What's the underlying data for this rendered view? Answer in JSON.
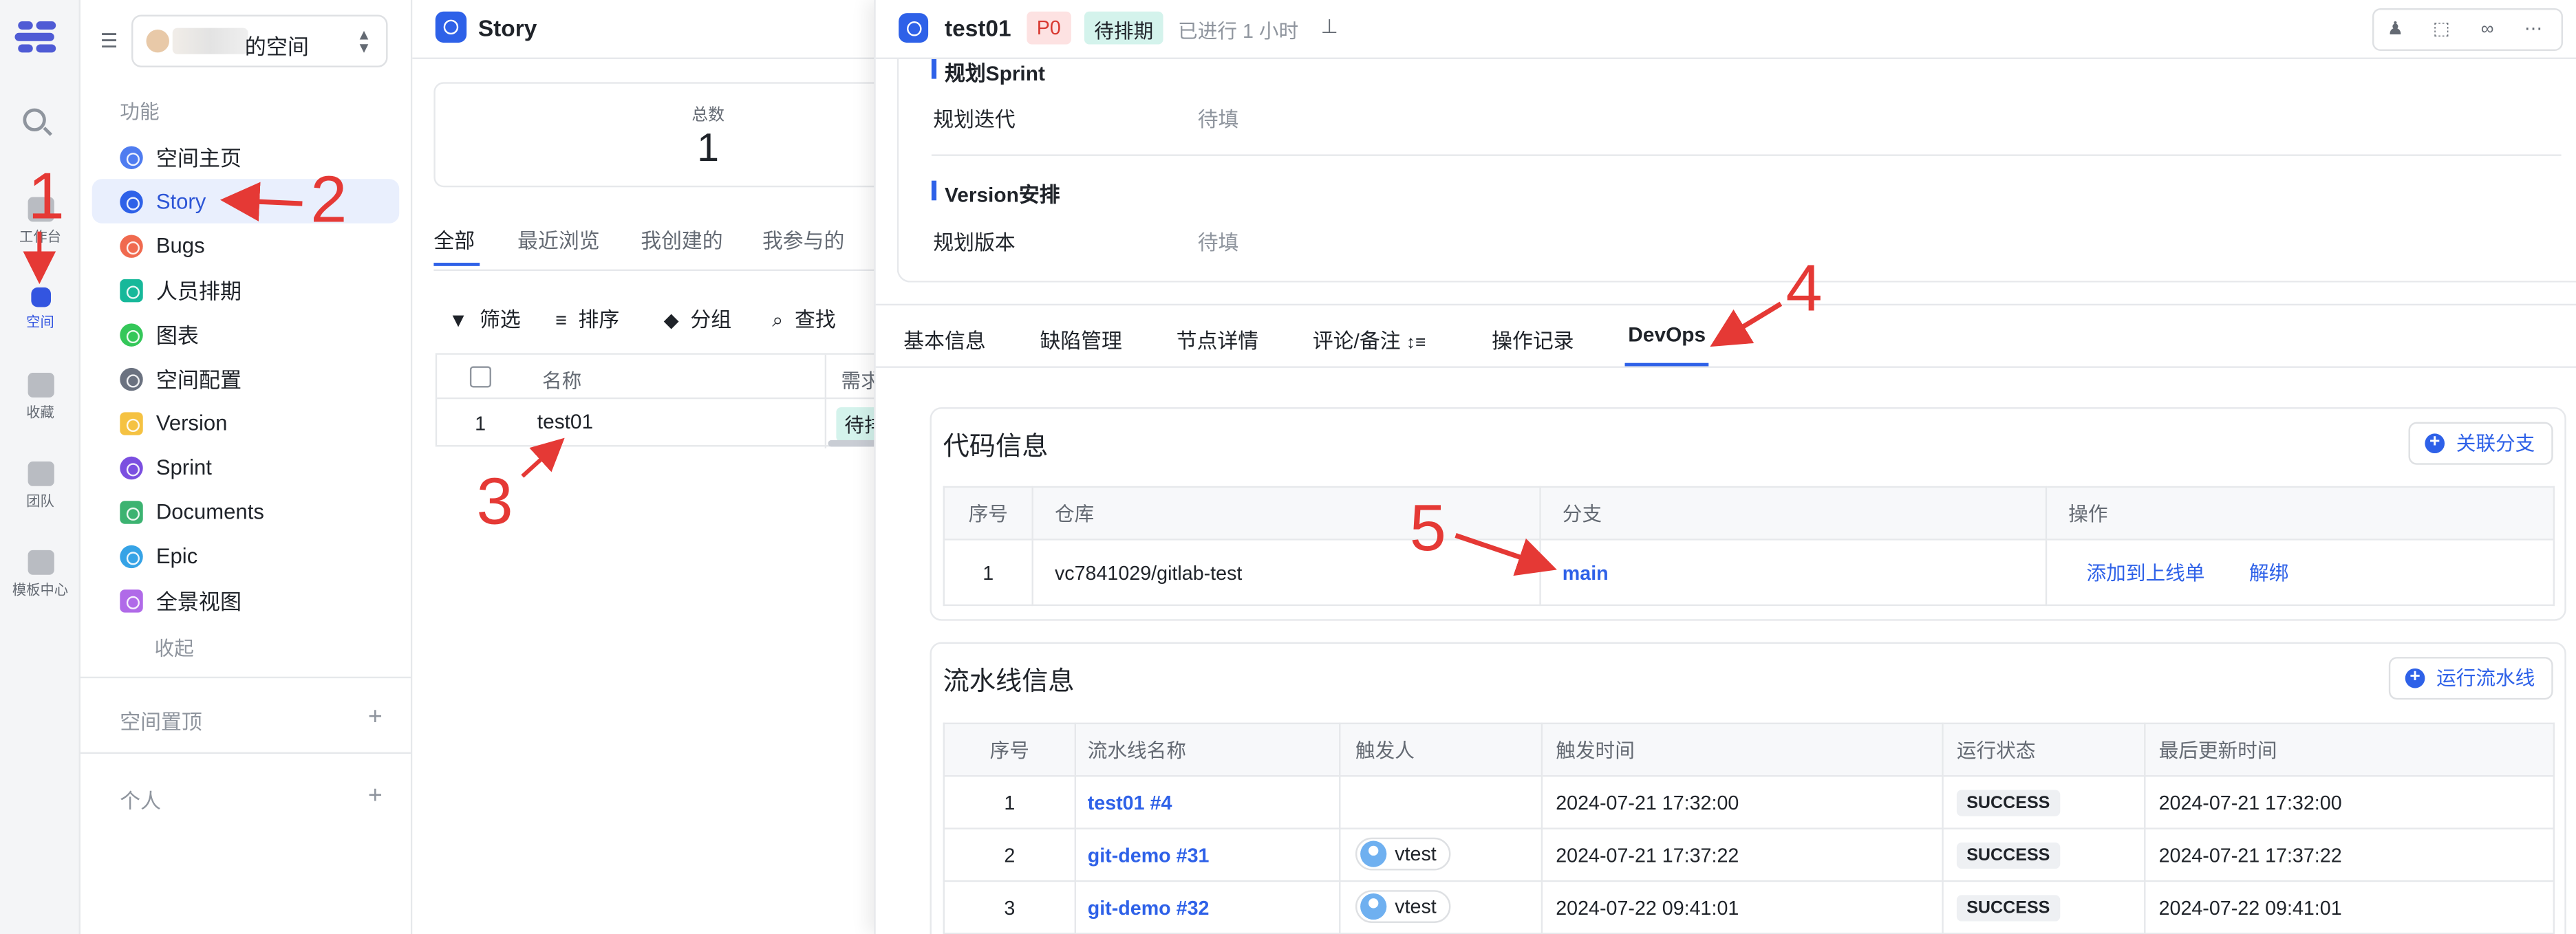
{
  "rail": {
    "items": [
      {
        "label": "工作台",
        "icon": "home-icon"
      },
      {
        "label": "空间",
        "icon": "space-icon"
      },
      {
        "label": "收藏",
        "icon": "star-icon"
      },
      {
        "label": "团队",
        "icon": "team-icon"
      },
      {
        "label": "模板中心",
        "icon": "template-icon"
      }
    ]
  },
  "sidebar": {
    "space_name": "的空间",
    "section_label": "功能",
    "items": [
      {
        "label": "空间主页",
        "color": "#4f7cf0"
      },
      {
        "label": "Story",
        "color": "#2e61e8"
      },
      {
        "label": "Bugs",
        "color": "#f06a4f"
      },
      {
        "label": "人员排期",
        "color": "#17b89a"
      },
      {
        "label": "图表",
        "color": "#34c759"
      },
      {
        "label": "空间配置",
        "color": "#6b7280"
      },
      {
        "label": "Version",
        "color": "#f5c242"
      },
      {
        "label": "Sprint",
        "color": "#7b4fe0"
      },
      {
        "label": "Documents",
        "color": "#3cb371"
      },
      {
        "label": "Epic",
        "color": "#36a3e6"
      },
      {
        "label": "全景视图",
        "color": "#b06ae8"
      }
    ],
    "collapse_label": "收起",
    "pinned_label": "空间置顶",
    "personal_label": "个人"
  },
  "list": {
    "title": "Story",
    "stat_label": "总数",
    "stat_value": "1",
    "tabs": [
      "全部",
      "最近浏览",
      "我创建的",
      "我参与的"
    ],
    "tools": [
      "筛选",
      "排序",
      "分组",
      "查找"
    ],
    "columns": {
      "name": "名称",
      "req": "需求"
    },
    "row": {
      "index": "1",
      "name": "test01",
      "status": "待排"
    }
  },
  "detail": {
    "title": "test01",
    "priority": "P0",
    "status": "待排期",
    "elapsed": "已进行 1 小时",
    "sprint_section": "规划Sprint",
    "sprint_key": "规划迭代",
    "sprint_value": "待填",
    "version_section": "Version安排",
    "version_key": "规划版本",
    "version_value": "待填",
    "tabs": [
      "基本信息",
      "缺陷管理",
      "节点详情",
      "评论/备注",
      "操作记录",
      "DevOps"
    ],
    "code": {
      "title": "代码信息",
      "button": "关联分支",
      "columns": [
        "序号",
        "仓库",
        "分支",
        "操作"
      ],
      "rows": [
        {
          "index": "1",
          "repo": "vc7841029/gitlab-test",
          "branch": "main",
          "action1": "添加到上线单",
          "action2": "解绑"
        }
      ]
    },
    "pipeline": {
      "title": "流水线信息",
      "button": "运行流水线",
      "columns": [
        "序号",
        "流水线名称",
        "触发人",
        "触发时间",
        "运行状态",
        "最后更新时间"
      ],
      "rows": [
        {
          "index": "1",
          "name": "test01 #4",
          "user": "",
          "time": "2024-07-21 17:32:00",
          "status": "SUCCESS",
          "updated": "2024-07-21 17:32:00"
        },
        {
          "index": "2",
          "name": "git-demo #31",
          "user": "vtest",
          "time": "2024-07-21 17:37:22",
          "status": "SUCCESS",
          "updated": "2024-07-21 17:37:22"
        },
        {
          "index": "3",
          "name": "git-demo #32",
          "user": "vtest",
          "time": "2024-07-22 09:41:01",
          "status": "SUCCESS",
          "updated": "2024-07-22 09:41:01"
        }
      ]
    }
  },
  "annotations": [
    "1",
    "2",
    "3",
    "4",
    "5"
  ]
}
